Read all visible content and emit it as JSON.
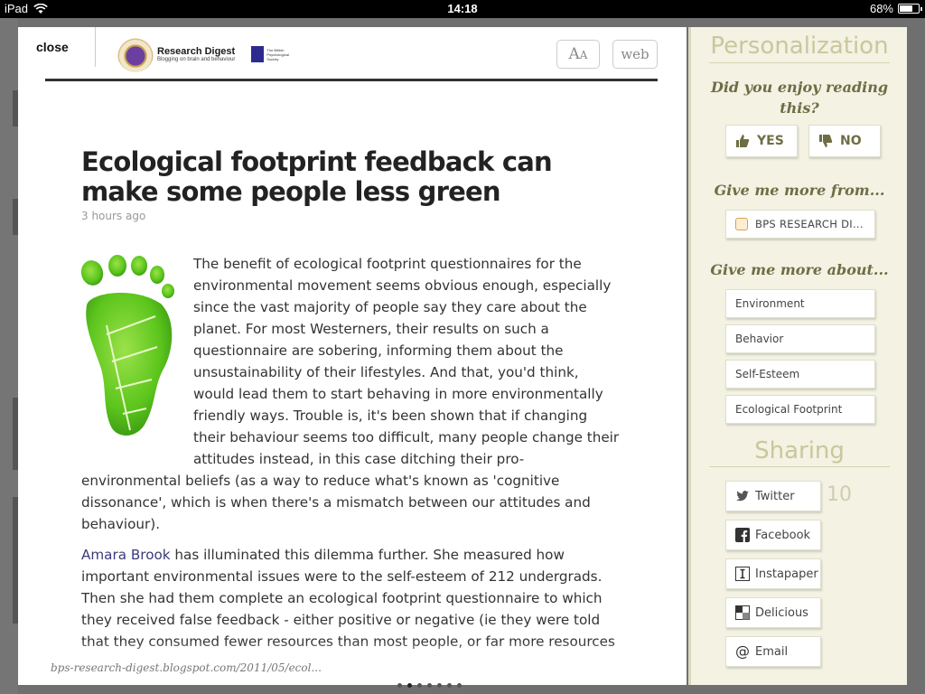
{
  "status_bar": {
    "device": "iPad",
    "time": "14:18",
    "battery_percent": "68%",
    "battery_level": 0.68
  },
  "article_header": {
    "close_label": "close",
    "logo": {
      "title": "Research Digest",
      "subtitle": "Blogging on brain and behaviour",
      "partner": "The British Psychological Society"
    },
    "font_button": {
      "big": "A",
      "small": "A"
    },
    "web_button": "web"
  },
  "article": {
    "headline": "Ecological footprint feedback can make some people less green",
    "age": "3 hours ago",
    "image_icon": "green-footprint-icon",
    "paragraph1": "The benefit of ecological footprint questionnaires for the environmental movement seems obvious enough, especially since the vast majority of people say they care about the planet. For most Westerners, their results on such a questionnaire are sobering, informing them about the unsustainability of their lifestyles. And that, you'd think, would lead them to start behaving in more environmentally friendly ways. Trouble is, it's been shown that if changing their behaviour seems too difficult, many people change their attitudes instead, in this case ditching their pro-environmental beliefs (as a way to reduce what's known as 'cognitive dissonance', which is when there's a mismatch between our attitudes and behaviour).",
    "paragraph2_author": "Amara Brook",
    "paragraph2_rest": " has illuminated this dilemma further. She measured how important environmental issues were to the self-esteem of 212 undergrads. Then she had them complete an ecological footprint questionnaire to which they received false feedback - either positive or negative (ie they were told that they consumed fewer resources than most people, or far more resources",
    "source_url_domain": "bps-research-digest.blogspot.com",
    "source_url_path": "/2011/05/ecol..."
  },
  "personalization": {
    "heading": "Personalization",
    "question": "Did you enjoy reading this?",
    "yes_label": "YES",
    "no_label": "NO",
    "more_from_heading": "Give me more from...",
    "source_label": "BPS RESEARCH DI...",
    "more_about_heading": "Give me more about...",
    "tags": [
      "Environment",
      "Behavior",
      "Self-Esteem",
      "Ecological Footprint"
    ]
  },
  "sharing": {
    "heading": "Sharing",
    "twitter_label": "Twitter",
    "twitter_count": "10",
    "facebook_label": "Facebook",
    "instapaper_label": "Instapaper",
    "delicious_label": "Delicious",
    "email_label": "Email"
  },
  "colors": {
    "panel_bg": "#f3f2e3",
    "heading_muted": "#c9c79c",
    "question_olive": "#6f6d45",
    "leaf_green": "#5cc51c"
  }
}
